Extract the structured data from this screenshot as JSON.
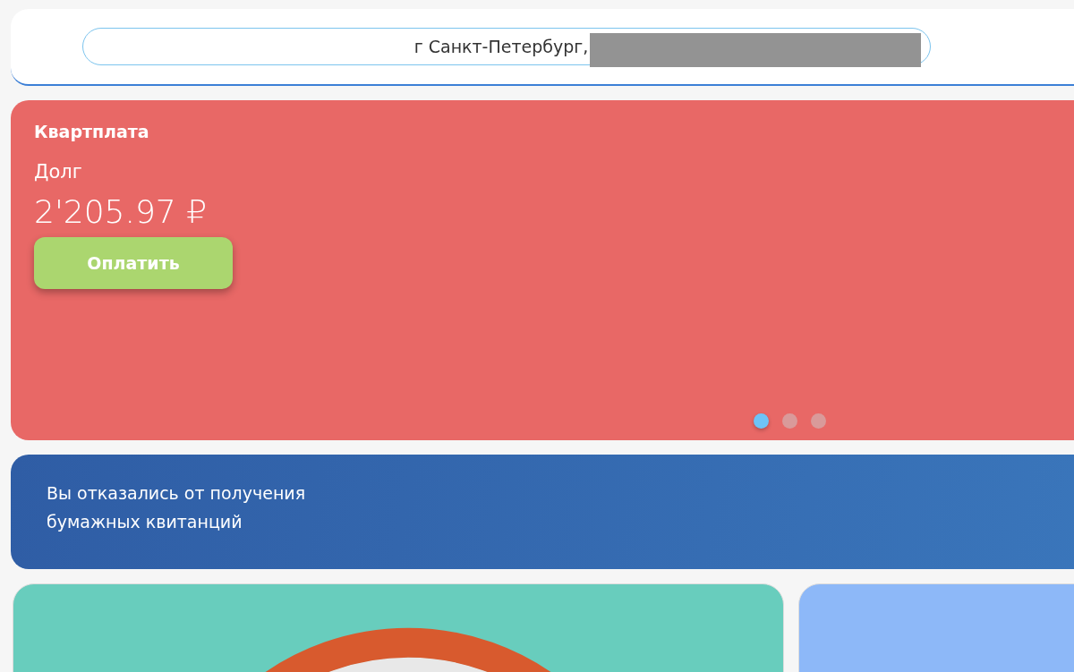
{
  "header": {
    "address": "г Санкт-Петербург,",
    "address_redacted": true
  },
  "payment_card": {
    "title": "Квартплата",
    "label": "Долг",
    "amount": "2'205.97 ₽",
    "button": "Оплатить",
    "pager": [
      {
        "selected": true
      },
      {
        "selected": false
      },
      {
        "selected": false
      }
    ]
  },
  "notice": {
    "lines": [
      "Вы отказались от получения",
      "бумажных квитанций"
    ]
  },
  "tiles": [
    {
      "kind": "ring"
    },
    {
      "kind": "plain"
    }
  ]
}
